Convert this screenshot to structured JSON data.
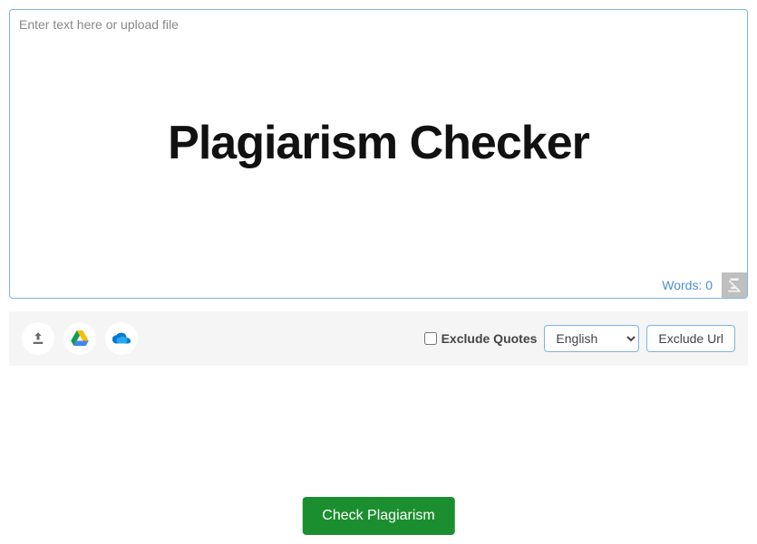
{
  "textarea": {
    "placeholder": "Enter text here or upload file",
    "watermark": "Plagiarism Checker"
  },
  "words": {
    "label": "Words: 0"
  },
  "toolbar": {
    "exclude_quotes_label": "Exclude Quotes",
    "language": "English",
    "exclude_url_label": "Exclude Url"
  },
  "submit": {
    "label": "Check Plagiarism"
  }
}
